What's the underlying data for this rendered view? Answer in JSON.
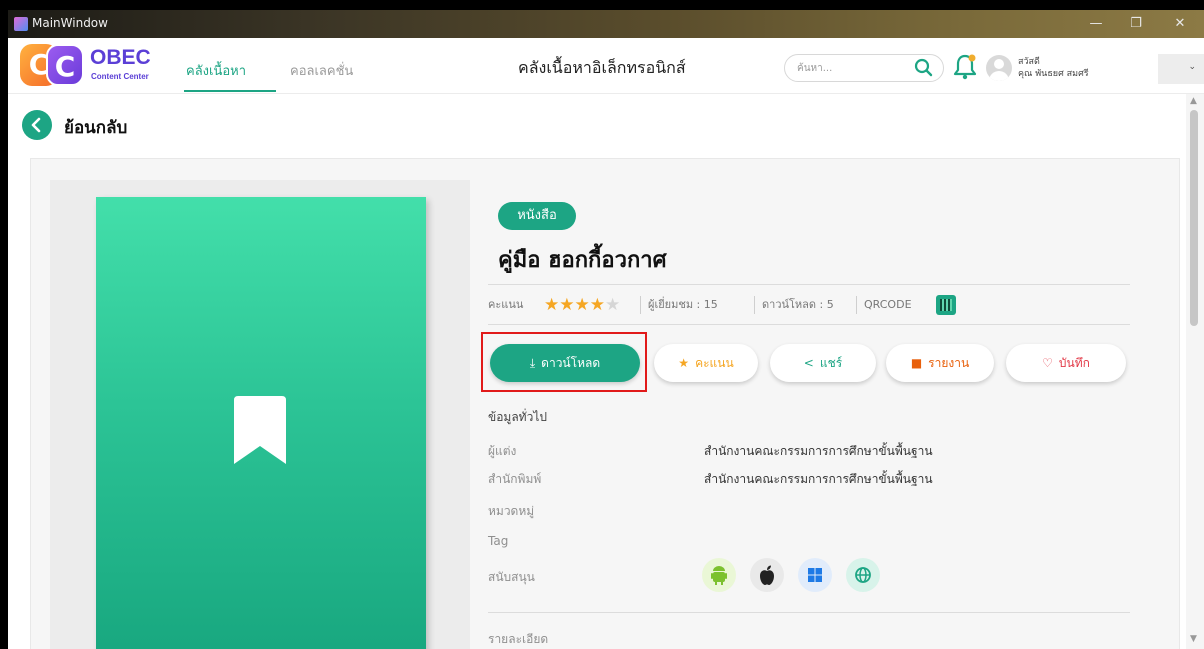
{
  "window": {
    "title": "MainWindow",
    "controls": [
      "—",
      "❐",
      "✕"
    ]
  },
  "header": {
    "logo": {
      "letters": [
        "C",
        "C"
      ],
      "brand": "OBEC",
      "subtitle": "Content Center"
    },
    "tabs": [
      {
        "label": "คลังเนื้อหา",
        "active": true
      },
      {
        "label": "คอลเลคชั่น",
        "active": false
      }
    ],
    "title": "คลังเนื้อหาอิเล็กทรอนิกส์",
    "search": {
      "placeholder": "ค้นหา..."
    },
    "user": {
      "greeting": "สวัสดี",
      "name": "คุณ พันธยศ สมศรี"
    },
    "dropdown_icon": "chevron-down-icon"
  },
  "back": {
    "label": "ย้อนกลับ"
  },
  "book": {
    "type_tag": "หนังสือ",
    "title": "คู่มือ ฮอกกี้อวกาศ",
    "rating_label": "คะแนน",
    "rating": 4,
    "rating_max": 5,
    "views": "ผู้เยี่ยมชม : 15",
    "downloads": "ดาวน์โหลด : 5",
    "qr_label": "QRCODE"
  },
  "actions": [
    {
      "label": "ดาวน์โหลด",
      "icon": "download-icon"
    },
    {
      "label": "คะแนน",
      "icon": "star-icon"
    },
    {
      "label": "แชร์",
      "icon": "share-icon"
    },
    {
      "label": "รายงาน",
      "icon": "report-icon"
    },
    {
      "label": "บันทึก",
      "icon": "heart-icon"
    }
  ],
  "info": {
    "heading": "ข้อมูลทั่วไป",
    "author_label": "ผู้แต่ง",
    "author": "สำนักงานคณะกรรมการการศึกษาขั้นพื้นฐาน",
    "publisher_label": "สำนักพิมพ์",
    "publisher": "สำนักงานคณะกรรมการการศึกษาขั้นพื้นฐาน",
    "category_label": "หมวดหมู่",
    "tag_label": "Tag",
    "support_label": "สนับสนุน",
    "platforms": [
      "android-icon",
      "apple-icon",
      "windows-icon",
      "web-icon"
    ],
    "detail_label": "รายละเอียด"
  },
  "colors": {
    "accent": "#1da584",
    "highlight": "#e11a1a",
    "star": "#f5a623"
  }
}
